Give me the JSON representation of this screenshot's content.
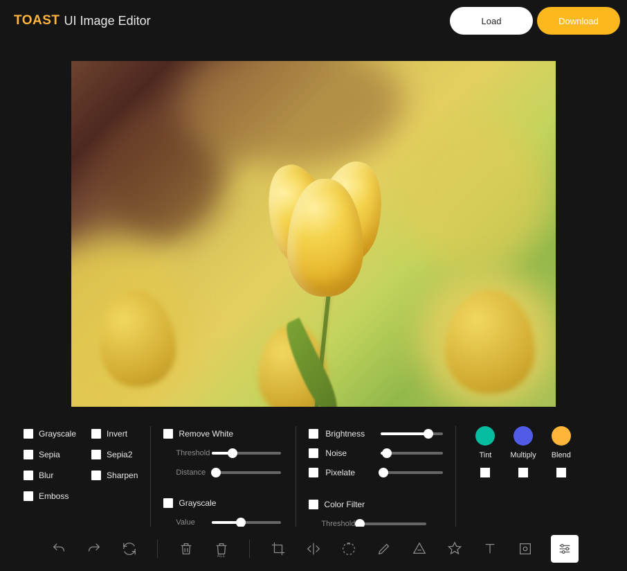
{
  "header": {
    "brand": "TOAST",
    "title": "UI Image Editor",
    "load_label": "Load",
    "download_label": "Download"
  },
  "filters": {
    "basic_left": [
      "Grayscale",
      "Sepia",
      "Blur",
      "Emboss"
    ],
    "basic_right": [
      "Invert",
      "Sepia2",
      "Sharpen"
    ],
    "remove_white": {
      "label": "Remove White",
      "threshold_label": "Threshold",
      "distance_label": "Distance",
      "threshold": 30,
      "distance": 6
    },
    "grayscale2": {
      "label": "Grayscale",
      "value_label": "Value",
      "value": 42
    },
    "brightness": {
      "label": "Brightness",
      "value": 76
    },
    "noise": {
      "label": "Noise",
      "value": 10
    },
    "pixelate": {
      "label": "Pixelate",
      "value": 4
    },
    "color_filter": {
      "label": "Color Filter",
      "threshold_label": "Threshold",
      "threshold": 4
    },
    "tint_label": "Tint",
    "multiply_label": "Multiply",
    "blend_label": "Blend",
    "colors": {
      "tint": "#03bd9e",
      "multiply": "#515ce6",
      "blend": "#ffb43a"
    }
  },
  "toolbar": {
    "undo": "undo",
    "redo": "redo",
    "reset": "reset",
    "delete": "delete",
    "delete_all": "delete-all",
    "delete_all_text": "ALL",
    "crop": "crop",
    "flip": "flip",
    "rotate": "rotate",
    "draw": "draw",
    "shape": "shape",
    "icon": "icon",
    "text": "text",
    "mask": "mask",
    "filter": "filter"
  }
}
